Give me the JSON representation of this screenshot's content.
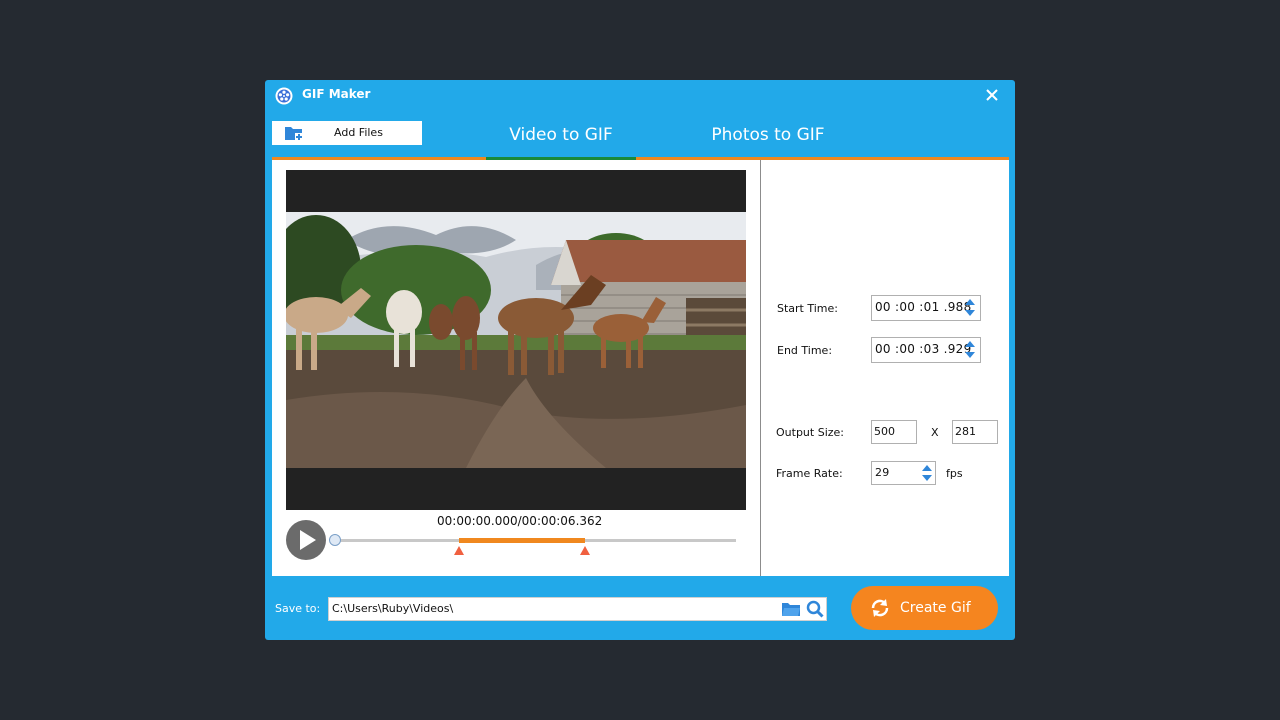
{
  "window": {
    "title": "GIF Maker"
  },
  "toolbar": {
    "add_files_label": "Add Files"
  },
  "tabs": [
    {
      "label": "Video to GIF",
      "active": true
    },
    {
      "label": "Photos to GIF",
      "active": false
    }
  ],
  "player": {
    "time_current": "00:00:00.000",
    "time_separator": "/",
    "time_total": "00:00:06.362",
    "playhead_fraction": 0.0,
    "selection_start_fraction": 0.312,
    "selection_end_fraction": 0.624
  },
  "settings": {
    "start_time_label": "Start Time:",
    "start_time_value": "00 :00 :01 .988",
    "end_time_label": "End Time:",
    "end_time_value": "00 :00 :03 .929",
    "output_size_label": "Output Size:",
    "output_width": "500",
    "size_separator": "X",
    "output_height": "281",
    "frame_rate_label": "Frame Rate:",
    "frame_rate_value": "29",
    "frame_rate_unit": "fps"
  },
  "footer": {
    "save_to_label": "Save to:",
    "save_path": "C:\\Users\\Ruby\\Videos\\",
    "create_button_label": "Create Gif"
  },
  "colors": {
    "window_blue": "#22a9e9",
    "accent_orange": "#f5851f",
    "tab_underline_green": "#1a8a3a",
    "marker_red": "#f06040",
    "spinner_blue": "#2f86d9"
  }
}
